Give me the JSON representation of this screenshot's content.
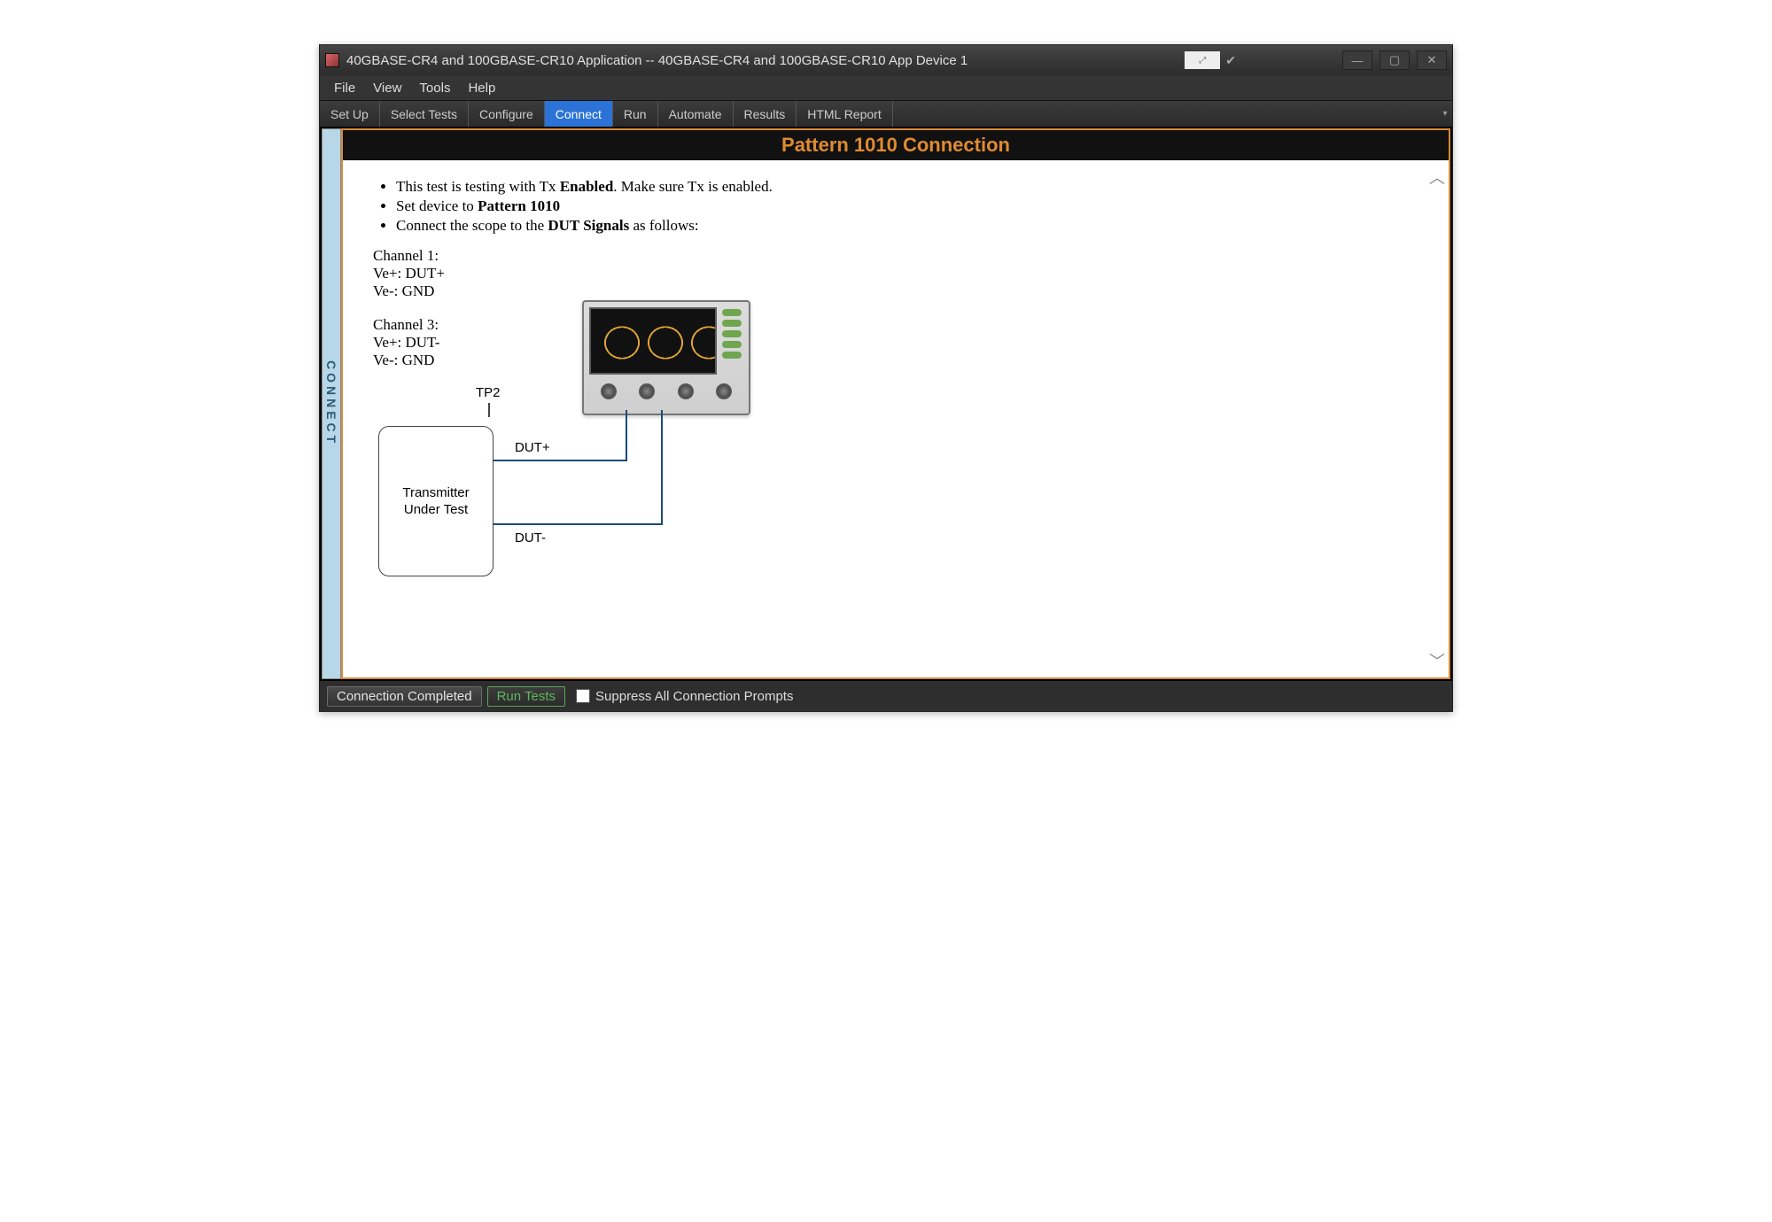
{
  "titlebar": {
    "title": "40GBASE-CR4 and 100GBASE-CR10 Application -- 40GBASE-CR4 and 100GBASE-CR10 App Device 1"
  },
  "menubar": [
    "File",
    "View",
    "Tools",
    "Help"
  ],
  "tabs": [
    "Set Up",
    "Select Tests",
    "Configure",
    "Connect",
    "Run",
    "Automate",
    "Results",
    "HTML Report"
  ],
  "active_tab_index": 3,
  "side_label": "CONNECT",
  "panel": {
    "header": "Pattern 1010 Connection",
    "bullet1_pre": "This test is testing with Tx ",
    "bullet1_bold": "Enabled",
    "bullet1_post": ". Make sure Tx is enabled.",
    "bullet2_pre": "Set device to ",
    "bullet2_bold": "Pattern 1010",
    "bullet3_pre": "Connect the scope to the ",
    "bullet3_bold": "DUT Signals",
    "bullet3_post": " as follows:",
    "ch1_title": "Channel 1:",
    "ch1_l1": "Ve+: DUT+",
    "ch1_l2": "Ve-: GND",
    "ch3_title": "Channel 3:",
    "ch3_l1": "Ve+: DUT-",
    "ch3_l2": "Ve-: GND"
  },
  "diagram": {
    "tp2": "TP2",
    "dut_box": "Transmitter Under Test",
    "dut_plus": "DUT+",
    "dut_minus": "DUT-"
  },
  "footer": {
    "status": "Connection Completed",
    "run": "Run Tests",
    "suppress": "Suppress All Connection Prompts"
  }
}
